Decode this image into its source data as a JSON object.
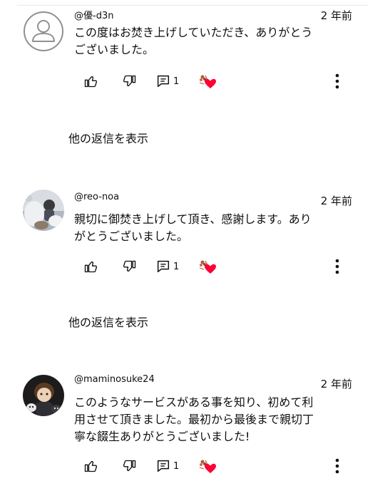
{
  "comments": [
    {
      "author": "@優-d3n",
      "time": "2 年前",
      "text_lines": [
        "この度はお焚き上げしていただき、ありがとう",
        "ございました。"
      ],
      "reply_count": "1",
      "show_replies": "他の返信を表示",
      "avatar": "default-person-icon"
    },
    {
      "author": "@reo-noa",
      "time": "2 年前",
      "text_lines": [
        "親切に御焚き上げして頂き、感謝します。あり",
        "がとうございました。"
      ],
      "reply_count": "1",
      "show_replies": "他の返信を表示",
      "avatar": "photo-avatar"
    },
    {
      "author": "@maminosuke24",
      "time": "2 年前",
      "text_lines": [
        "このようなサービスがある事を知り、初めて利",
        "用させて頂きました。最初から最後まで親切丁",
        "寧な餟生ありがとうございました!"
      ],
      "reply_count": "1",
      "avatar": "photo-avatar"
    }
  ],
  "icons": {
    "like": "thumbs-up-icon",
    "dislike": "thumbs-down-icon",
    "reply": "comment-icon",
    "creator_heart": "creator-heart-icon",
    "more": "more-vertical-icon"
  },
  "colors": {
    "heart": "#ff0033",
    "text": "#0f0f0f",
    "icon": "#0f0f0f"
  }
}
